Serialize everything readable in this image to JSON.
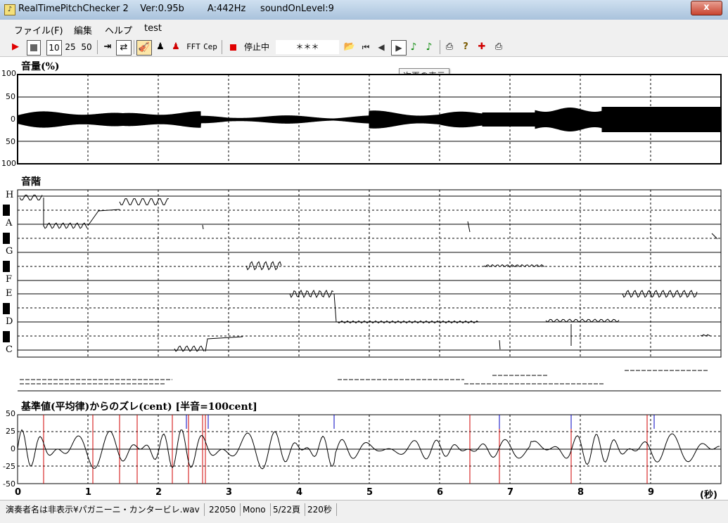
{
  "window": {
    "title": "RealTimePitchChecker 2    Ver:0.95b        A:442Hz     soundOnLevel:9",
    "close_label": "x"
  },
  "menu": [
    "ファイル(F)",
    "編集",
    "ヘルプ",
    "test"
  ],
  "toolbar": {
    "btn_10": "10",
    "btn_25": "25",
    "btn_50": "50",
    "fft": "FFT",
    "cep": "Cep",
    "status": "停止中",
    "note_display": "＊＊＊"
  },
  "tooltip": "次頁の表示",
  "volume_panel": {
    "title": "音量(%)",
    "y_labels": [
      "100",
      "50",
      "0",
      "50",
      "100"
    ]
  },
  "scale_panel": {
    "title": "音階",
    "notes": [
      "H",
      "A",
      "G",
      "F",
      "E",
      "D",
      "C"
    ]
  },
  "cent_panel": {
    "title": "基準値(平均律)からのズレ(cent) [半音=100cent]",
    "y_labels": [
      "50",
      "25",
      "0",
      "-25",
      "-50"
    ]
  },
  "x_axis": {
    "labels": [
      "0",
      "1",
      "2",
      "3",
      "4",
      "5",
      "6",
      "7",
      "8",
      "9"
    ],
    "unit": "(秒)"
  },
  "status": {
    "file": "演奏者名は非表示¥パガニーニ・カンタービレ.wav",
    "rate": "22050",
    "channels": "Mono",
    "page": "5/22頁",
    "duration": "220秒"
  }
}
